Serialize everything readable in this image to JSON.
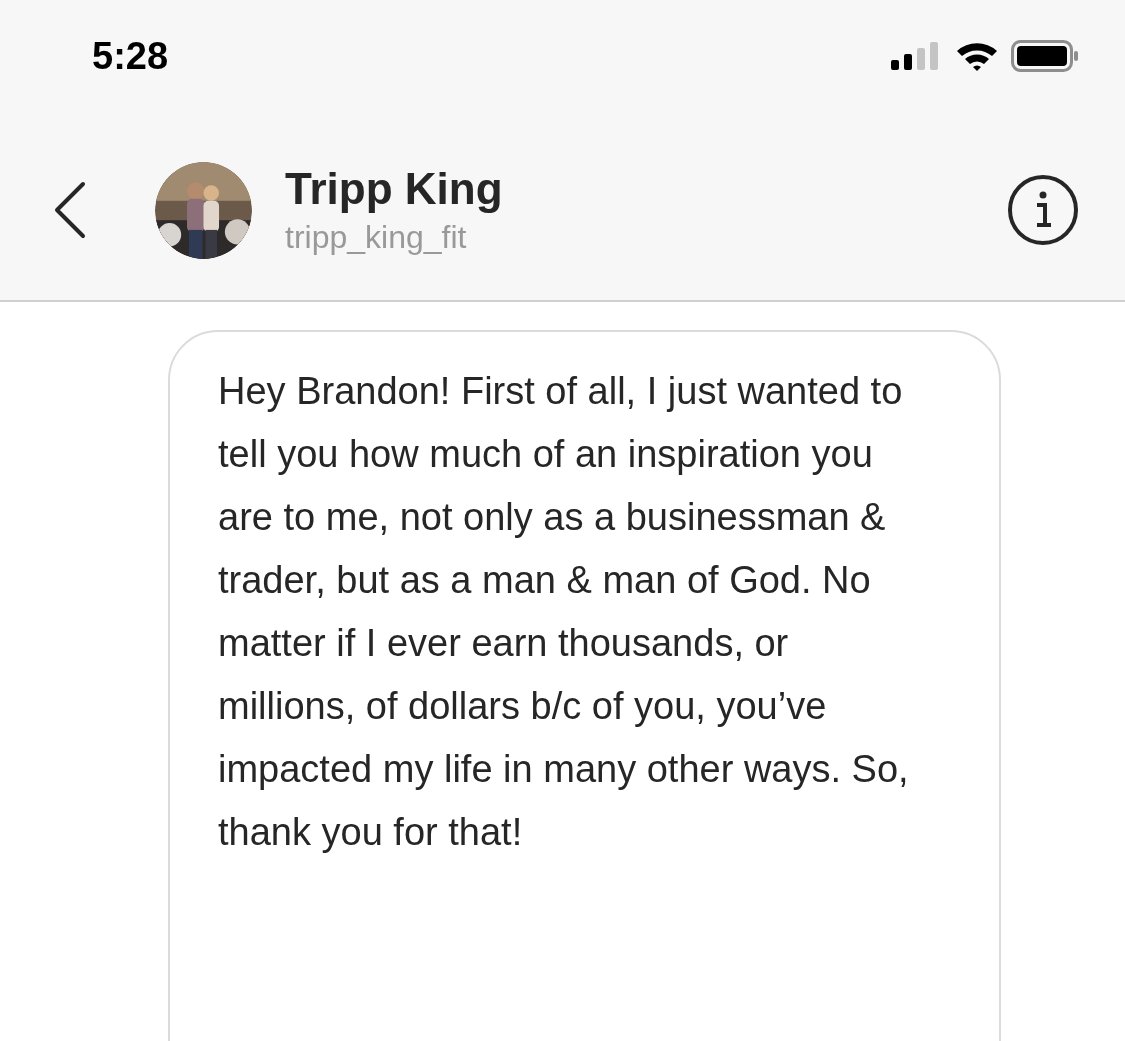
{
  "status_bar": {
    "time": "5:28"
  },
  "header": {
    "name": "Tripp King",
    "username": "tripp_king_fit"
  },
  "messages": [
    {
      "text": "Hey Brandon! First of all, I just wanted to tell you how much of an inspiration you are to me, not only as a businessman & trader, but as a man & man of God. No matter if I ever earn thousands, or millions, of dollars b/c of you, you’ve impacted my life in many other ways. So, thank you for that!"
    }
  ]
}
